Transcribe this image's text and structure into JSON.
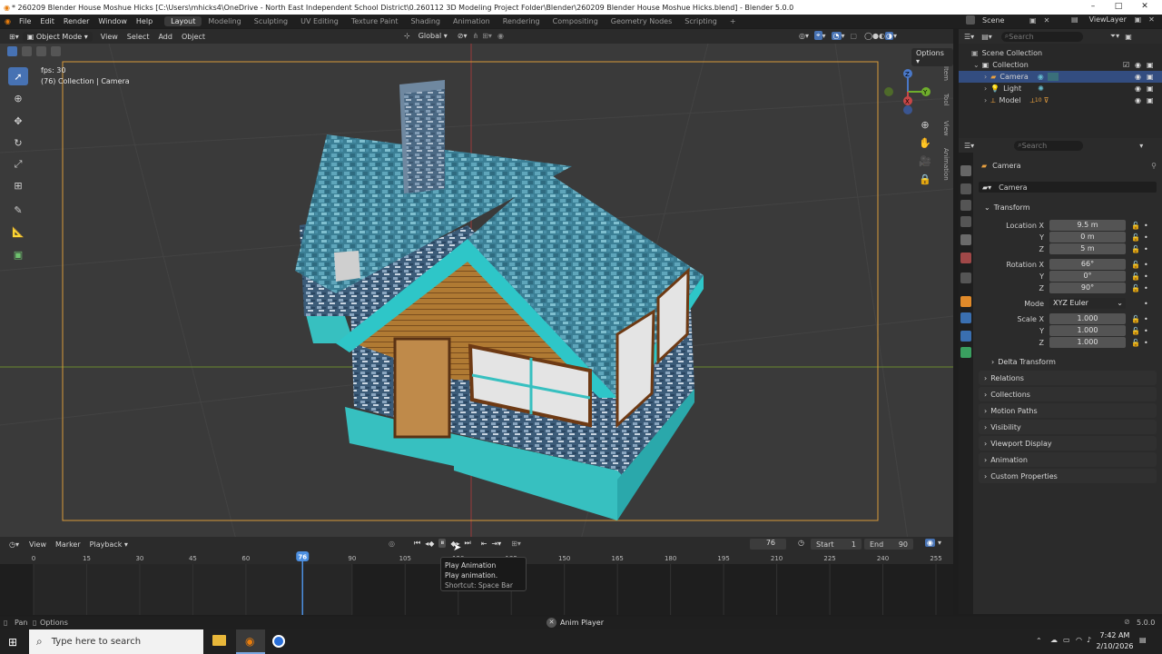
{
  "window": {
    "title": "* 260209 Blender House Moshue Hicks [C:\\Users\\mhicks4\\OneDrive - North East Independent School District\\0.260112 3D Modeling Project Folder\\Blender\\260209 Blender House Moshue Hicks.blend] - Blender 5.0.0",
    "controls": [
      "–",
      "□",
      "✕"
    ]
  },
  "menu": {
    "items": [
      "File",
      "Edit",
      "Render",
      "Window",
      "Help"
    ],
    "workspaces": [
      "Layout",
      "Modeling",
      "Sculpting",
      "UV Editing",
      "Texture Paint",
      "Shading",
      "Animation",
      "Rendering",
      "Compositing",
      "Geometry Nodes",
      "Scripting"
    ],
    "active_workspace": "Layout",
    "add_tab": "+",
    "scene": "Scene",
    "view_layer": "ViewLayer"
  },
  "viewport_header": {
    "mode": "Object Mode",
    "menus": [
      "View",
      "Select",
      "Add",
      "Object"
    ],
    "orientation": "Global"
  },
  "viewport": {
    "fps": "fps: 30",
    "collection_label": "(76) Collection | Camera",
    "options": "Options",
    "side_tabs": [
      "Item",
      "Tool",
      "View",
      "Animation"
    ],
    "gizmo": {
      "z": "Z",
      "x": "X",
      "y": "Y"
    }
  },
  "outliner": {
    "search_placeholder": "Search",
    "root": "Scene Collection",
    "collection": "Collection",
    "items": [
      {
        "name": "Camera",
        "selected": true
      },
      {
        "name": "Light",
        "selected": false
      },
      {
        "name": "Model",
        "selected": false
      }
    ],
    "model_modifier_count": "10"
  },
  "properties": {
    "search_placeholder": "Search",
    "object_header": "Camera",
    "object_name": "Camera",
    "transform_title": "Transform",
    "location": {
      "label": "Location X",
      "x": "9.5 m",
      "y": "0 m",
      "z": "5 m"
    },
    "rotation": {
      "label": "Rotation X",
      "x": "66°",
      "y": "0°",
      "z": "90°"
    },
    "mode": {
      "label": "Mode",
      "value": "XYZ Euler"
    },
    "scale": {
      "label": "Scale X",
      "x": "1.000",
      "y": "1.000",
      "z": "1.000"
    },
    "axis_y": "Y",
    "axis_z": "Z",
    "delta_transform": "Delta Transform",
    "panels": [
      "Relations",
      "Collections",
      "Motion Paths",
      "Visibility",
      "Viewport Display",
      "Animation",
      "Custom Properties"
    ]
  },
  "timeline": {
    "menus": [
      "View",
      "Marker",
      "Playback"
    ],
    "current_frame": "76",
    "start_label": "Start",
    "start": "1",
    "end_label": "End",
    "end": "90",
    "ticks": [
      "0",
      "15",
      "30",
      "45",
      "60",
      "90",
      "105",
      "120",
      "135",
      "150",
      "165",
      "180",
      "195",
      "210",
      "225",
      "240",
      "255"
    ],
    "frame_range": [
      0,
      90
    ],
    "playhead_frame": 76,
    "max_frame": 255
  },
  "tooltip": {
    "title": "Play Animation",
    "description": "Play animation.",
    "shortcut": "Shortcut: Space Bar"
  },
  "statusbar": {
    "pan": "Pan",
    "options": "Options",
    "anim_player": "Anim Player",
    "version": "5.0.0"
  },
  "taskbar": {
    "search_placeholder": "Type here to search",
    "time": "7:42 AM",
    "date": "2/10/2026"
  }
}
